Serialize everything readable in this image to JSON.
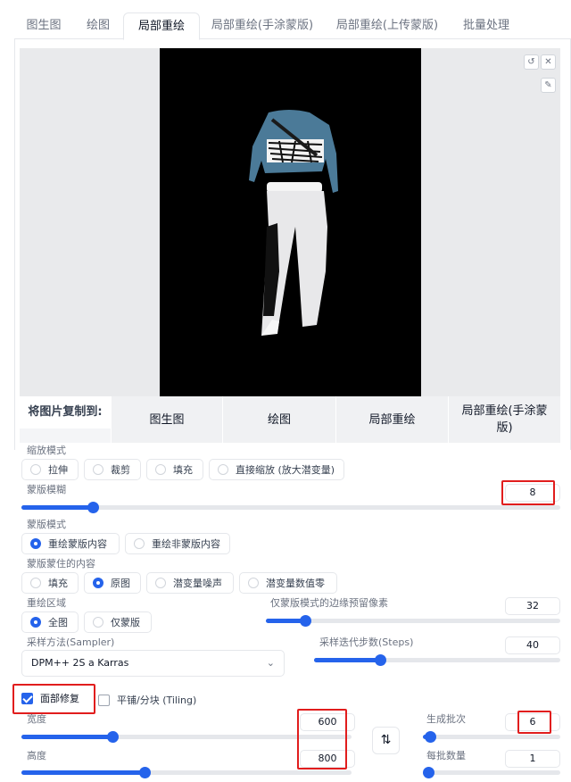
{
  "tabs": [
    {
      "label": "图生图",
      "active": false
    },
    {
      "label": "绘图",
      "active": false
    },
    {
      "label": "局部重绘",
      "active": true
    },
    {
      "label": "局部重绘(手涂蒙版)",
      "active": false
    },
    {
      "label": "局部重绘(上传蒙版)",
      "active": false
    },
    {
      "label": "批量处理",
      "active": false
    }
  ],
  "image_panel": {
    "undo_icon": "↺",
    "close_icon": "✕",
    "brush_icon": "✎"
  },
  "copy_to": {
    "label": "将图片复制到:",
    "buttons": [
      "图生图",
      "绘图",
      "局部重绘",
      "局部重绘(手涂蒙版)"
    ]
  },
  "resize_mode": {
    "label": "缩放模式",
    "options": [
      "拉伸",
      "裁剪",
      "填充",
      "直接缩放 (放大潜变量)"
    ],
    "selected": null
  },
  "mask_blur": {
    "label": "蒙版模糊",
    "value": "8",
    "fraction": 0.125
  },
  "mask_mode": {
    "label": "蒙版模式",
    "options": [
      "重绘蒙版内容",
      "重绘非蒙版内容"
    ],
    "selected": 0
  },
  "masked_content": {
    "label": "蒙版蒙住的内容",
    "options": [
      "填充",
      "原图",
      "潜变量噪声",
      "潜变量数值零"
    ],
    "selected": 1
  },
  "inpaint_area": {
    "label": "重绘区域",
    "options": [
      "全图",
      "仅蒙版"
    ],
    "selected": 0
  },
  "only_masked_padding": {
    "label": "仅蒙版模式的边缘预留像素",
    "value": "32",
    "fraction": 0.125
  },
  "sampler": {
    "label": "采样方法(Sampler)",
    "value": "DPM++ 2S a Karras"
  },
  "steps": {
    "label": "采样迭代步数(Steps)",
    "value": "40",
    "fraction": 0.27
  },
  "restore_faces": {
    "label": "面部修复",
    "checked": true
  },
  "tiling": {
    "label": "平铺/分块 (Tiling)",
    "checked": false
  },
  "width": {
    "label": "宽度",
    "value": "600",
    "fraction": 0.27
  },
  "height": {
    "label": "高度",
    "value": "800",
    "fraction": 0.37
  },
  "swap_icon": "⇅",
  "batch_count": {
    "label": "生成批次",
    "value": "6",
    "fraction": 0.04
  },
  "batch_size": {
    "label": "每批数量",
    "value": "1",
    "fraction": 0.0
  },
  "colors": {
    "accent": "#2563eb",
    "highlight": "#e11d1d",
    "jacket": "#4b7a98",
    "pants": "#e8e8ea"
  }
}
